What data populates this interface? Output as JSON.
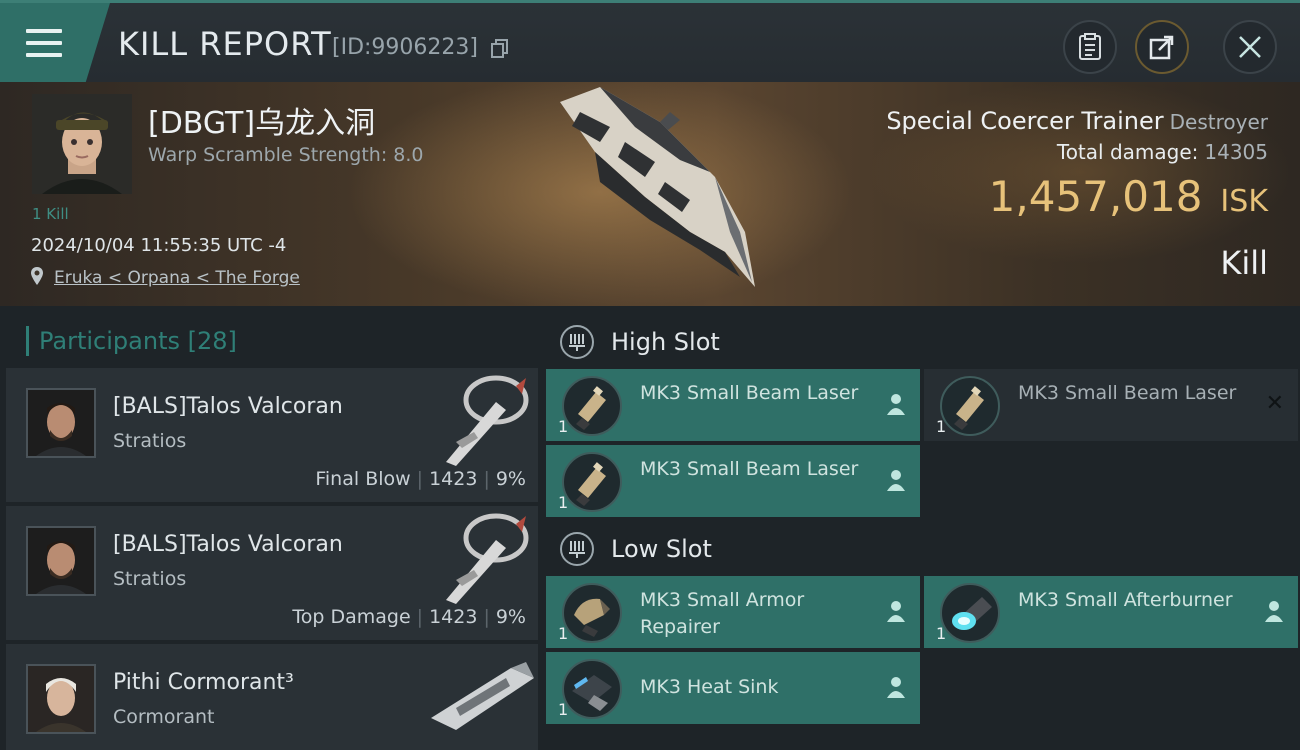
{
  "header": {
    "title": "KILL REPORT",
    "report_id": "[ID:9906223]"
  },
  "victim": {
    "name": "[DBGT]乌龙入洞",
    "warp_scramble": "Warp Scramble Strength: 8.0",
    "kills": "1 Kill",
    "timestamp": "2024/10/04 11:55:35 UTC -4",
    "location": "Eruka < Orpana < The Forge",
    "ship_name": "Special Coercer Trainer",
    "ship_class": "Destroyer",
    "total_damage_label": "Total damage:",
    "total_damage": "14305",
    "isk_value": "1,457,018",
    "isk_unit": "ISK",
    "result": "Kill"
  },
  "participants": {
    "label": "Participants",
    "count": "[28]",
    "rows": [
      {
        "name": "[BALS]Talos Valcoran",
        "ship": "Stratios",
        "tag": "Final Blow",
        "damage": "1423",
        "percent": "9%"
      },
      {
        "name": "[BALS]Talos Valcoran",
        "ship": "Stratios",
        "tag": "Top Damage",
        "damage": "1423",
        "percent": "9%"
      },
      {
        "name": "Pithi Cormorant³",
        "ship": "Cormorant"
      }
    ]
  },
  "fitting": {
    "high_slot": {
      "label": "High Slot",
      "modules": [
        {
          "name": "MK3 Small Beam Laser",
          "qty": "1"
        },
        {
          "name": "MK3 Small Beam Laser",
          "qty": "1"
        },
        {
          "name": "MK3 Small Beam Laser",
          "qty": "1"
        }
      ]
    },
    "low_slot": {
      "label": "Low Slot",
      "modules": [
        {
          "name": "MK3 Small Armor Repairer",
          "qty": "1"
        },
        {
          "name": "MK3 Small Afterburner",
          "qty": "1"
        },
        {
          "name": "MK3 Heat Sink",
          "qty": "1"
        }
      ]
    }
  },
  "colors": {
    "accent_teal": "#2f7068",
    "isk_gold": "#e7c27a",
    "participant_header": "#2f7f77"
  },
  "icons": [
    "menu-icon",
    "copy-icon",
    "clipboard-icon",
    "share-icon",
    "close-icon",
    "location-pin-icon",
    "high-slot-icon",
    "low-slot-icon",
    "pilot-icon"
  ]
}
